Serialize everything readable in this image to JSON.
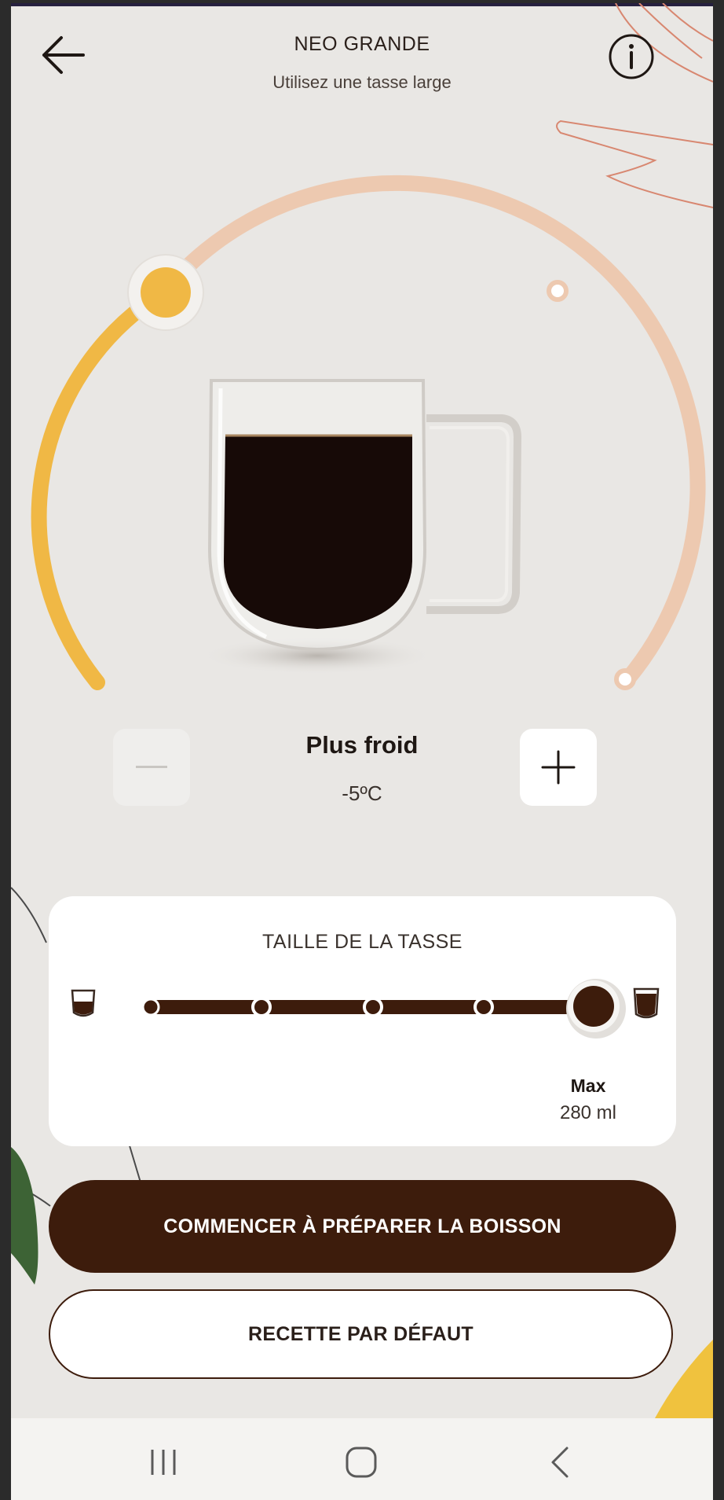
{
  "header": {
    "title": "NEO GRANDE",
    "subtitle": "Utilisez une tasse large",
    "back_icon": "arrow-left-icon",
    "info_icon": "info-icon"
  },
  "temperature": {
    "label": "Plus froid",
    "value": "-5ºC",
    "minus_icon": "minus-icon",
    "plus_icon": "plus-icon",
    "selected_step": 1,
    "total_steps": 3
  },
  "cup_size": {
    "title": "TAILLE DE LA TASSE",
    "selected_label": "Max",
    "selected_value": "280 ml",
    "selected_step": 5,
    "total_steps": 5,
    "small_cup_icon": "small-cup-icon",
    "large_cup_icon": "large-cup-icon"
  },
  "actions": {
    "start_label": "COMMENCER À PRÉPARER LA BOISSON",
    "default_label": "RECETTE PAR DÉFAUT"
  },
  "navbar": {
    "recent_icon": "recent-apps-icon",
    "home_icon": "home-icon",
    "back_icon": "back-chevron-icon"
  },
  "colors": {
    "background": "#e9e7e4",
    "accent_yellow": "#f0b845",
    "arc_peach": "#edc9b0",
    "coffee_brown": "#3d1c0c",
    "card": "#ffffff"
  }
}
